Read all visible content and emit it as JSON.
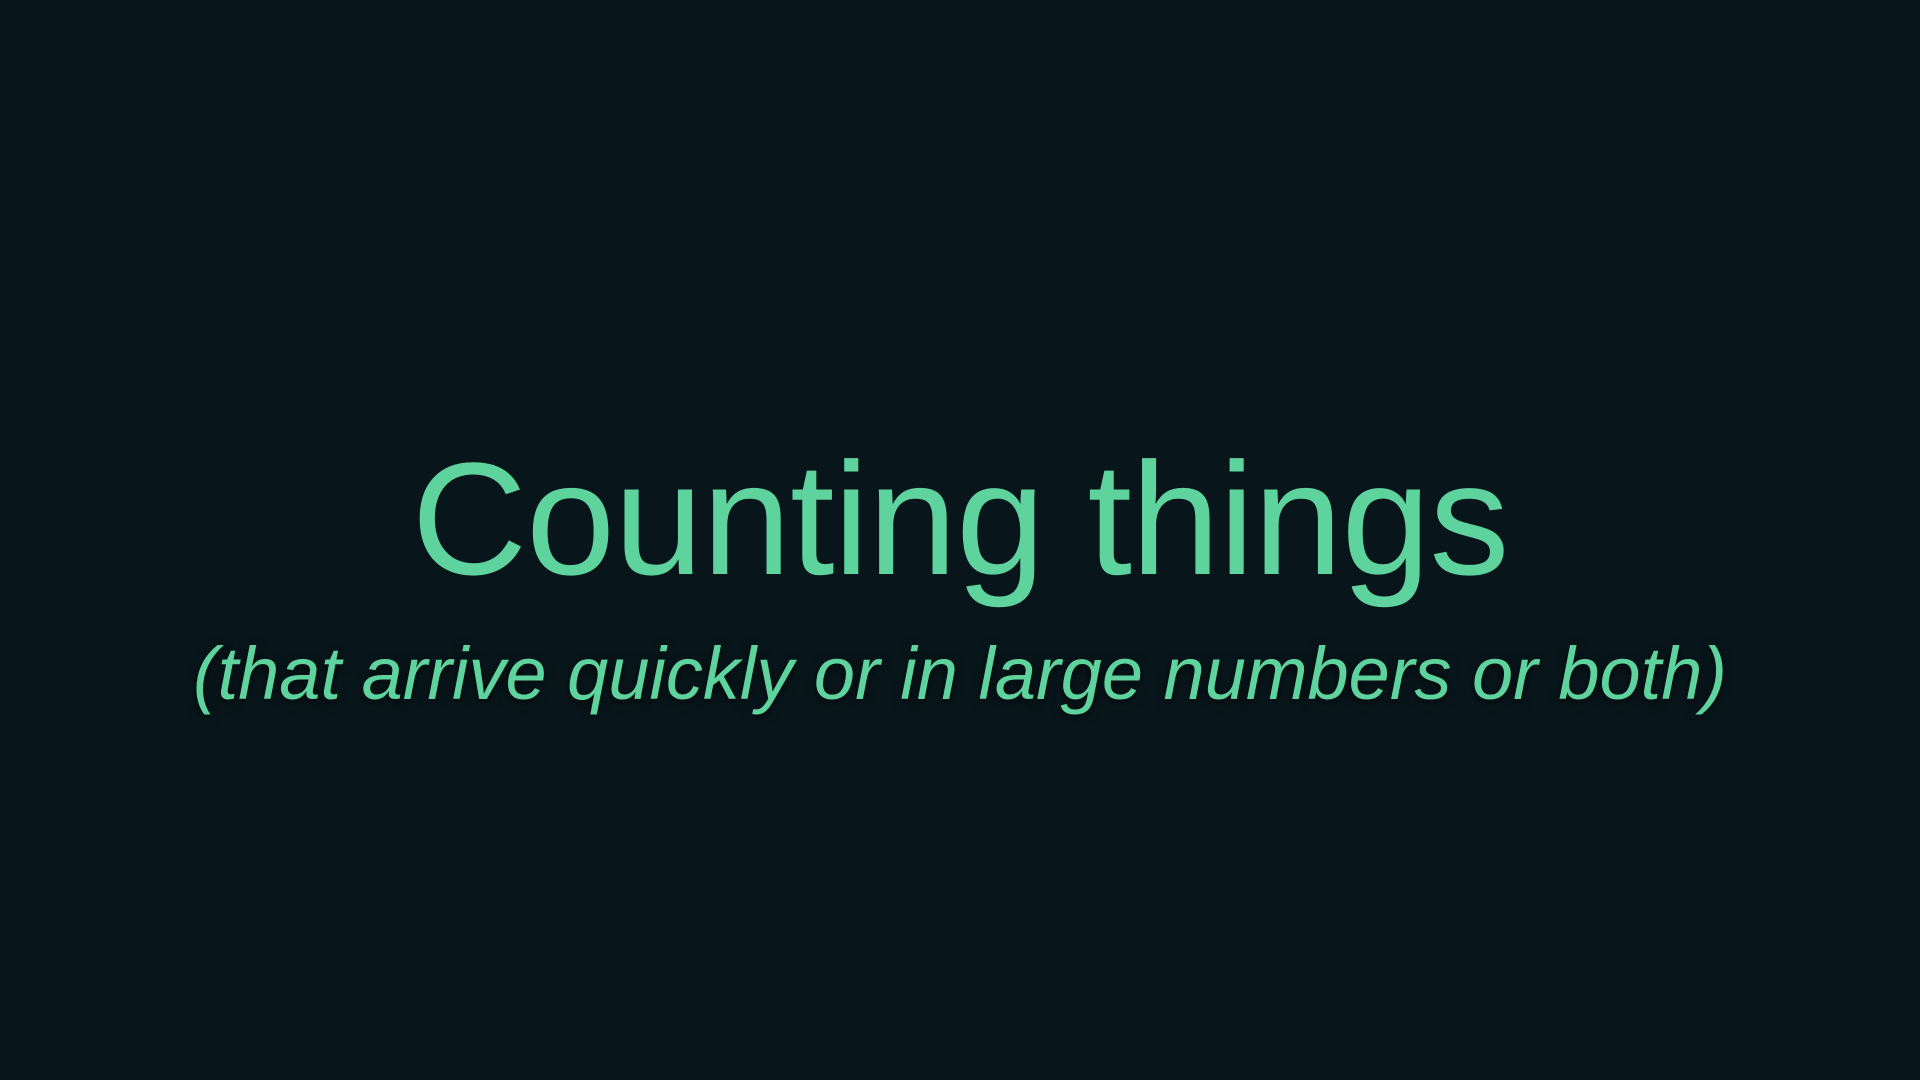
{
  "slide": {
    "title": "Counting things",
    "subtitle": "(that arrive quickly or in large numbers or both)"
  },
  "colors": {
    "background": "#08161b",
    "text": "#5fd39e"
  }
}
